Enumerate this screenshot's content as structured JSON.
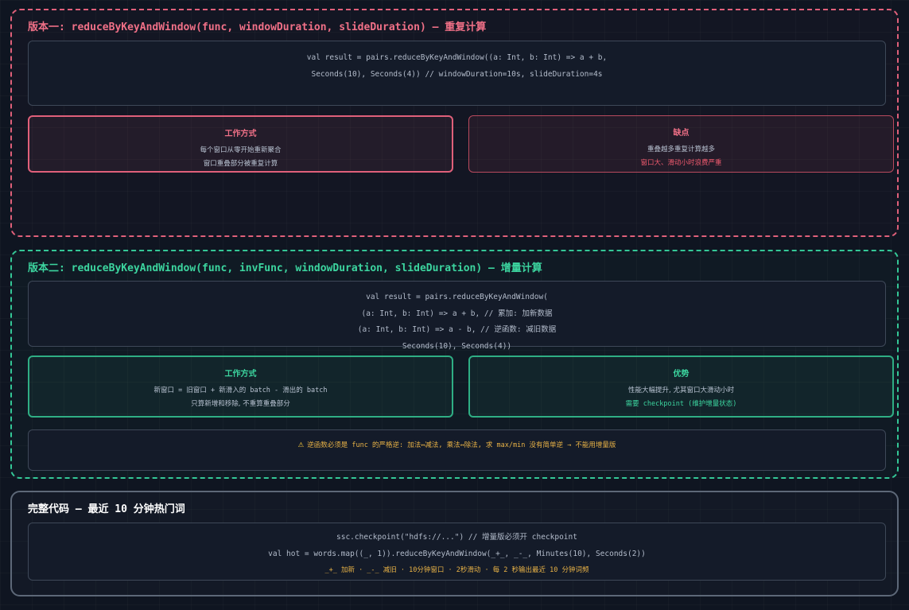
{
  "version1": {
    "title": "版本一: reduceByKeyAndWindow(func, windowDuration, slideDuration) — 重复计算",
    "code": [
      "val result = pairs.reduceByKeyAndWindow((a: Int, b: Int) => a + b,",
      "Seconds(10), Seconds(4)) // windowDuration=10s, slideDuration=4s"
    ],
    "how": {
      "title": "工作方式",
      "lines": [
        "每个窗口从零开始重新聚合",
        "窗口重叠部分被重复计算"
      ]
    },
    "cons": {
      "title": "缺点",
      "lines": [
        "重叠越多重复计算越多",
        "窗口大、滑动小时浪费严重"
      ]
    }
  },
  "version2": {
    "title": "版本二: reduceByKeyAndWindow(func, invFunc, windowDuration, slideDuration) — 增量计算",
    "code": [
      "val result = pairs.reduceByKeyAndWindow(",
      "(a: Int, b: Int) => a + b, // 累加: 加新数据",
      "(a: Int, b: Int) => a - b, // 逆函数: 减旧数据",
      "Seconds(10), Seconds(4))"
    ],
    "how": {
      "title": "工作方式",
      "lines": [
        "新窗口 = 旧窗口 + 新滑入的 batch - 滑出的 batch",
        "只算新增和移除, 不重算重叠部分"
      ]
    },
    "pros": {
      "title": "优势",
      "lines": [
        "性能大幅提升, 尤其窗口大滑动小时",
        "需要 checkpoint (维护增量状态)"
      ]
    },
    "warning": {
      "icon": "warning-icon",
      "text": "逆函数必须是 func 的严格逆: 加法↔减法, 乘法↔除法, 求 max/min 没有简单逆 → 不能用增量版"
    }
  },
  "full": {
    "title": "完整代码 — 最近 10 分钟热门词",
    "code": [
      "ssc.checkpoint(\"hdfs://...\") // 增量版必须开 checkpoint",
      "val hot = words.map((_, 1)).reduceByKeyAndWindow(_+_, _-_, Minutes(10), Seconds(2))"
    ],
    "note": "_+_ 加新 · _-_ 减旧 · 10分钟窗口 · 2秒滑动 · 每 2 秒输出最近 10 分钟词频"
  },
  "colors": {
    "version1_accent": "#e0607a",
    "version2_accent": "#34c897",
    "warning": "#e8b246"
  }
}
